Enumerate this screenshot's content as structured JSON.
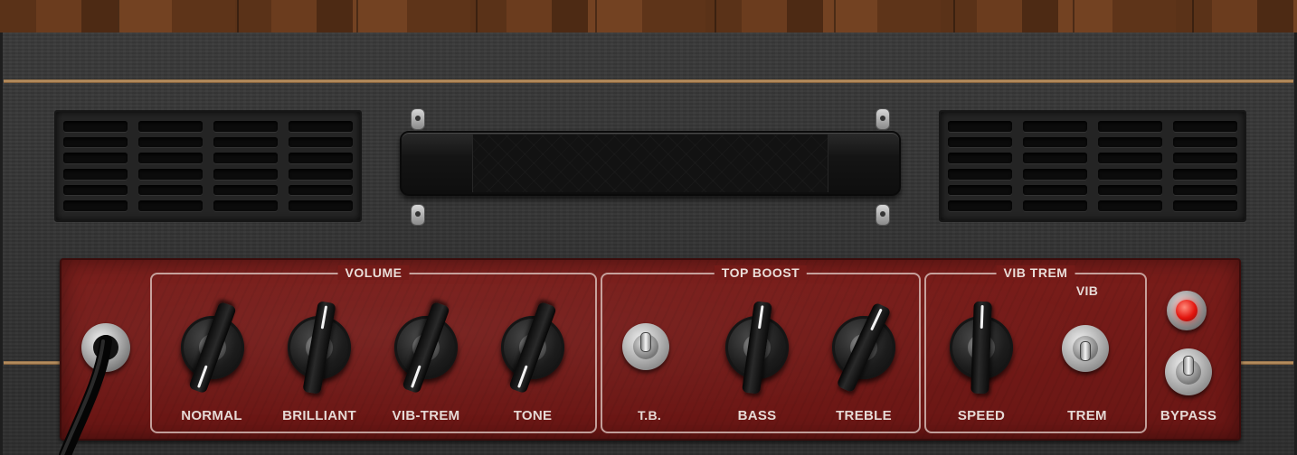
{
  "amp": {
    "volume_section": {
      "title": "VOLUME",
      "knobs": [
        {
          "label": "NORMAL"
        },
        {
          "label": "BRILLIANT"
        },
        {
          "label": "VIB-TREM"
        },
        {
          "label": "TONE"
        }
      ]
    },
    "top_boost_section": {
      "title": "TOP BOOST",
      "switch_label": "T.B.",
      "knobs": [
        {
          "label": "BASS"
        },
        {
          "label": "TREBLE"
        }
      ]
    },
    "vib_trem_section": {
      "title": "VIB TREM",
      "speed_label": "SPEED",
      "switch_top_label": "VIB",
      "switch_bottom_label": "TREM"
    },
    "bypass": {
      "label": "BYPASS",
      "led_color": "#e3160f"
    },
    "colors": {
      "panel": "#7a1d1a",
      "tolex": "#333333",
      "piping": "#c49a66"
    },
    "icons": [
      "input-jack-icon",
      "cable-icon",
      "power-led-icon",
      "toggle-switch-icon",
      "knob-icon",
      "handle-icon",
      "vent-grille-icon"
    ]
  }
}
